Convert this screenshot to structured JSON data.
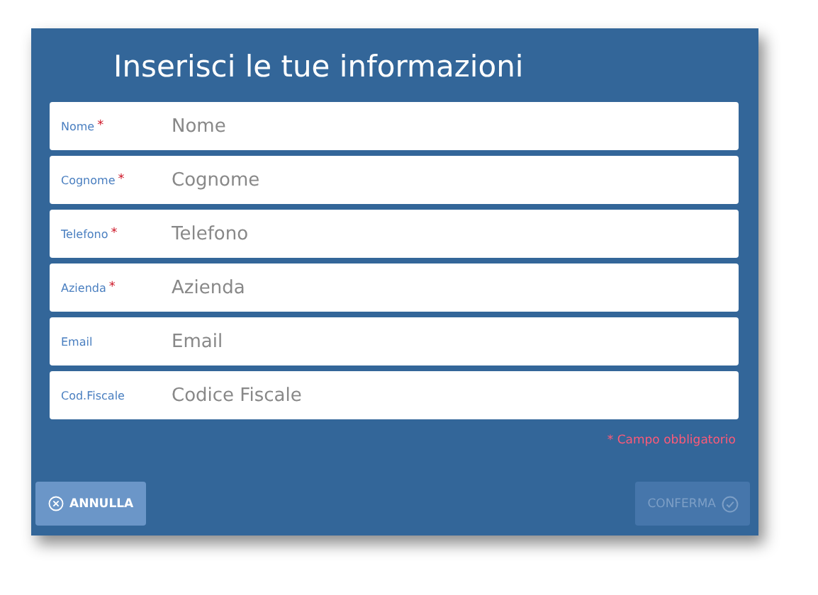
{
  "title": "Inserisci le tue informazioni",
  "required_mark": "*",
  "fields": [
    {
      "label": "Nome",
      "required": true,
      "placeholder": "Nome"
    },
    {
      "label": "Cognome",
      "required": true,
      "placeholder": "Cognome"
    },
    {
      "label": "Telefono",
      "required": true,
      "placeholder": "Telefono"
    },
    {
      "label": "Azienda",
      "required": true,
      "placeholder": "Azienda"
    },
    {
      "label": "Email",
      "required": false,
      "placeholder": "Email"
    },
    {
      "label": "Cod.Fiscale",
      "required": false,
      "placeholder": "Codice Fiscale"
    }
  ],
  "required_note": "* Campo obbligatorio",
  "buttons": [
    {
      "label": "ANNULLA",
      "kind": "cancel",
      "disabled": false
    },
    {
      "label": "CONFERMA",
      "kind": "confirm",
      "disabled": true
    }
  ]
}
